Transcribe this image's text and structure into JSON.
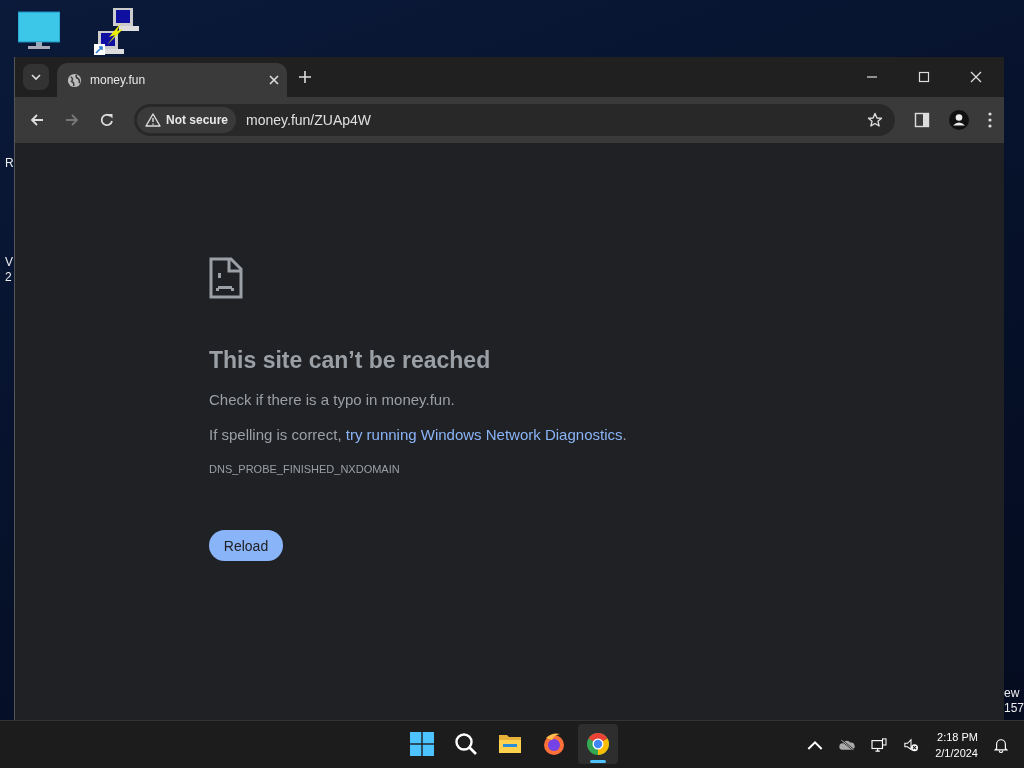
{
  "desktop": {
    "left_label_fragments": [
      "R",
      "V",
      "2"
    ],
    "right_label_fragments": [
      "ew",
      "157"
    ]
  },
  "browser": {
    "tabs": [
      {
        "title": "money.fun",
        "selected": true
      }
    ],
    "nav": [
      {
        "kind": "back",
        "disabled": false
      },
      {
        "kind": "forward",
        "disabled": true
      },
      {
        "kind": "reload",
        "disabled": false
      }
    ],
    "address": {
      "security": "Not secure",
      "url": "money.fun/ZUAp4W"
    },
    "error": {
      "title": "This site can’t be reached",
      "line_1": "Check if there is a typo in money.fun.",
      "line_2_prefix": "If spelling is correct, ",
      "line_2_link": "try running Windows Network Diagnostics",
      "line_2_suffix": ".",
      "code": "DNS_PROBE_FINISHED_NXDOMAIN",
      "button": "Reload"
    }
  },
  "taskbar": {
    "apps": [
      {
        "kind": "start",
        "selected": false
      },
      {
        "kind": "search",
        "selected": false
      },
      {
        "kind": "files",
        "selected": false
      },
      {
        "kind": "firefox",
        "selected": false
      },
      {
        "kind": "chrome",
        "selected": true
      }
    ],
    "time": "2:18 PM",
    "date": "2/1/2024"
  }
}
